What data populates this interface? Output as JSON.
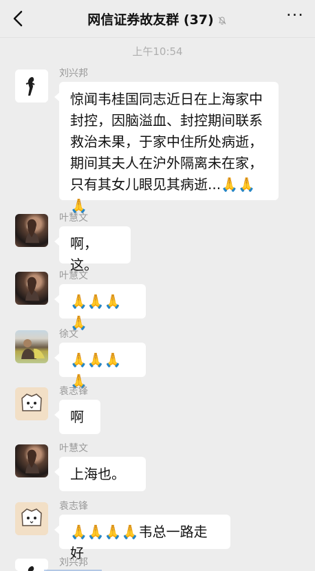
{
  "header": {
    "title": "网信证券故友群 (37)",
    "back_icon": "chevron-left-icon",
    "mute_icon": "bell-slash-icon",
    "more_label": "···"
  },
  "timestamp": "上午10:54",
  "messages": [
    {
      "name": "刘兴邦",
      "text": "惊闻韦桂国同志近日在上海家中封控，因脑溢血、封控期间联系救治未果，于家中住所处病逝，期间其夫人在沪外隔离未在家，只有其女儿眼见其病逝...🙏🙏🙏"
    },
    {
      "name": "叶慧文",
      "text": "啊，这。"
    },
    {
      "name": "叶慧文",
      "text": "🙏🙏🙏🙏"
    },
    {
      "name": "徐文",
      "text": "🙏🙏🙏🙏"
    },
    {
      "name": "袁志锋",
      "text": "啊"
    },
    {
      "name": "叶慧文",
      "text": "上海也。"
    },
    {
      "name": "袁志锋",
      "text": "🙏🙏🙏🙏韦总一路走好"
    },
    {
      "name": "刘兴邦",
      "text": ""
    }
  ]
}
